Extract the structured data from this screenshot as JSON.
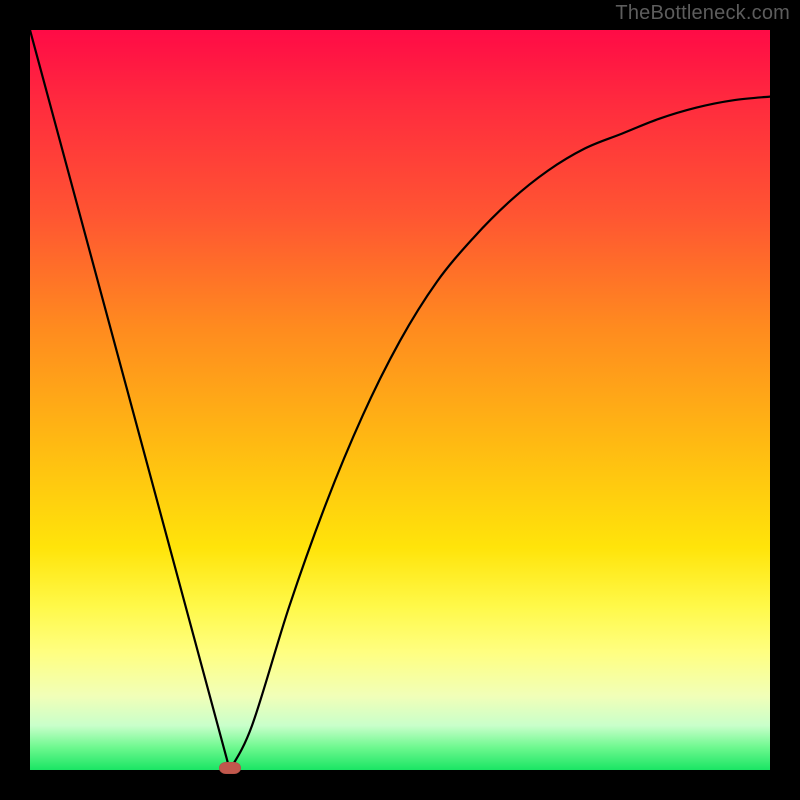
{
  "watermark": "TheBottleneck.com",
  "chart_data": {
    "type": "line",
    "title": "",
    "xlabel": "",
    "ylabel": "",
    "xlim": [
      0,
      100
    ],
    "ylim": [
      0,
      100
    ],
    "grid": false,
    "legend": false,
    "background_gradient": {
      "direction": "top-to-bottom",
      "stops": [
        {
          "pos": 0,
          "color": "#ff0b46"
        },
        {
          "pos": 25,
          "color": "#ff5532"
        },
        {
          "pos": 55,
          "color": "#ffb713"
        },
        {
          "pos": 84,
          "color": "#ffff80"
        },
        {
          "pos": 100,
          "color": "#1ae564"
        }
      ]
    },
    "series": [
      {
        "name": "bottleneck-curve",
        "x": [
          0,
          5,
          10,
          15,
          20,
          25,
          27,
          30,
          35,
          40,
          45,
          50,
          55,
          60,
          65,
          70,
          75,
          80,
          85,
          90,
          95,
          100
        ],
        "y": [
          100,
          82,
          63,
          45,
          27,
          9,
          0,
          6,
          22,
          36,
          48,
          58,
          66,
          72,
          77,
          81,
          84,
          86,
          88,
          89.5,
          90.5,
          91
        ]
      }
    ],
    "marker": {
      "name": "optimal-point",
      "x": 27,
      "y": 0,
      "color": "#c1584d"
    }
  }
}
